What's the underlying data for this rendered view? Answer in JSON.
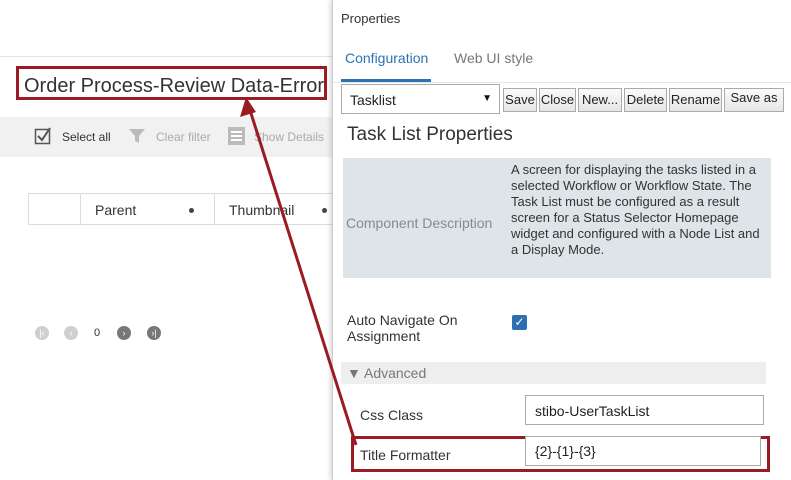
{
  "app": {
    "page_title": "Order Process-Review Data-Error",
    "toolbar": {
      "select_all": "Select all",
      "clear_filter": "Clear filter",
      "show_details": "Show Details"
    },
    "grid": {
      "columns": [
        "Parent",
        "Thumbnail"
      ]
    },
    "pager": {
      "page": "0"
    }
  },
  "panel": {
    "title": "Properties",
    "tabs": [
      "Configuration",
      "Web UI style"
    ],
    "selected_component": "Tasklist",
    "buttons": {
      "save": "Save",
      "close": "Close",
      "new": "New...",
      "delete": "Delete",
      "rename": "Rename",
      "save_as": "Save as"
    },
    "section_title": "Task List Properties",
    "component_description": {
      "label": "Component Description",
      "text": "A screen for displaying the tasks listed in a selected Workflow or Workflow State. The Task List must be configured as a result screen for a Status Selector Homepage widget and configured with a Node List and a Display Mode."
    },
    "auto_navigate": {
      "label": "Auto Navigate On Assignment",
      "checked": true
    },
    "advanced": {
      "label": "Advanced",
      "css_class": {
        "label": "Css Class",
        "value": "stibo-UserTaskList"
      },
      "title_formatter": {
        "label": "Title Formatter",
        "value": "{2}-{1}-{3}"
      }
    }
  },
  "colors": {
    "highlight": "#9b1b24",
    "accent": "#2a72b5",
    "description_bg": "#dde5e8"
  }
}
